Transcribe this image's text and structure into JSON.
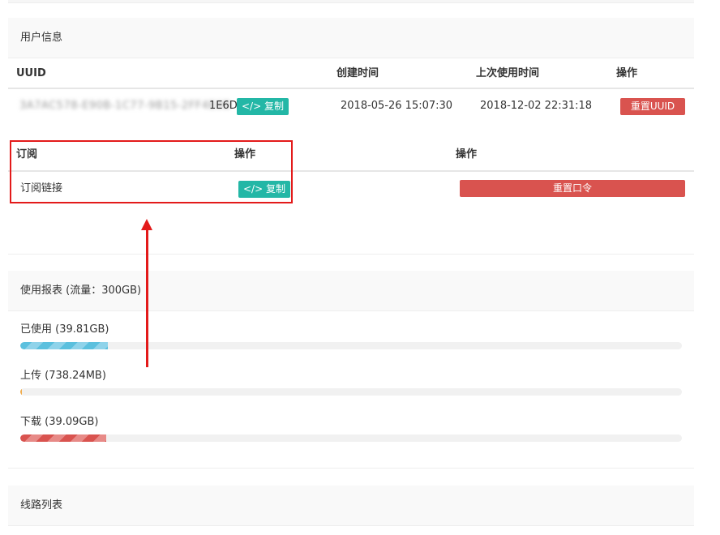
{
  "user_info": {
    "title": "用户信息",
    "columns": {
      "uuid": "UUID",
      "created": "创建时间",
      "last_used": "上次使用时间",
      "action": "操作"
    },
    "row": {
      "uuid_masked": "3A7AC578-E90B-1C77-9B15-2FF4E0D",
      "uuid_suffix": "1E6D",
      "copy_label": "复制",
      "created": "2018-05-26 15:07:30",
      "last_used": "2018-12-02 22:31:18",
      "reset_uuid_label": "重置UUID"
    },
    "subscription": {
      "col_subscribe": "订阅",
      "col_action": "操作",
      "col_action2": "操作",
      "link_label": "订阅链接",
      "copy_label": "复制",
      "reset_token_label": "重置口令"
    }
  },
  "usage": {
    "title": "使用报表 (流量：300GB)",
    "items": [
      {
        "label": "已使用 (39.81GB)",
        "fraction": 0.1327,
        "color": "blue"
      },
      {
        "label": "上传 (738.24MB)",
        "fraction": 0.0024,
        "color": "orange"
      },
      {
        "label": "下载 (39.09GB)",
        "fraction": 0.1303,
        "color": "red"
      }
    ]
  },
  "routes": {
    "title": "线路列表"
  },
  "colors": {
    "accent_teal": "#23b7a6",
    "danger_red": "#d9534f",
    "highlight_red": "#e31a1a"
  }
}
